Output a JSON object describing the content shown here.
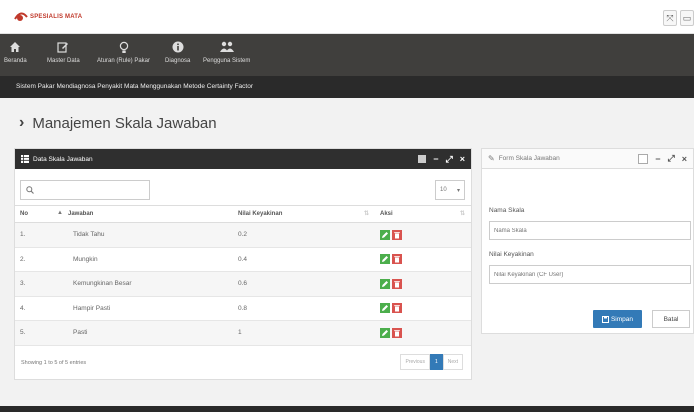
{
  "header": {
    "logo_text": "SPESIALIS MATA",
    "icons": [
      "expand-icon",
      "window-icon"
    ]
  },
  "nav": {
    "items": [
      {
        "label": "Beranda",
        "icon": "home-icon"
      },
      {
        "label": "Master Data",
        "icon": "edit-icon"
      },
      {
        "label": "Aturan (Rule) Pakar",
        "icon": "lightbulb-icon"
      },
      {
        "label": "Diagnosa",
        "icon": "info-icon"
      },
      {
        "label": "Pengguna Sistem",
        "icon": "users-icon"
      }
    ]
  },
  "subbar": {
    "text": "Sistem Pakar Mendiagnosa Penyakit Mata Menggunakan Metode Certainty Factor"
  },
  "page": {
    "title": "Manajemen Skala Jawaban"
  },
  "table_panel": {
    "title": "Data Skala Jawaban",
    "page_length": "10",
    "columns": [
      "No",
      "Jawaban",
      "Nilai Keyakinan",
      "Aksi"
    ],
    "rows": [
      {
        "no": "1.",
        "jawaban": "Tidak Tahu",
        "nilai": "0.2"
      },
      {
        "no": "2.",
        "jawaban": "Mungkin",
        "nilai": "0.4"
      },
      {
        "no": "3.",
        "jawaban": "Kemungkinan Besar",
        "nilai": "0.6"
      },
      {
        "no": "4.",
        "jawaban": "Hampir Pasti",
        "nilai": "0.8"
      },
      {
        "no": "5.",
        "jawaban": "Pasti",
        "nilai": "1"
      }
    ],
    "info": "Showing 1 to 5 of 5 entries",
    "pager": {
      "prev": "Previous",
      "current": "1",
      "next": "Next"
    }
  },
  "form_panel": {
    "title": "Form Skala Jawaban",
    "field1_label": "Nama Skala",
    "field1_placeholder": "Nama Skala",
    "field2_label": "Nilai Keyakinan",
    "field2_placeholder": "Nilai Keyakinan (CF User)",
    "save_label": "Simpan",
    "cancel_label": "Batal"
  },
  "colors": {
    "accent": "#337ab7",
    "nav_bg": "#403f3d",
    "edit_green": "#4cae4c",
    "delete_red": "#d9534f"
  }
}
